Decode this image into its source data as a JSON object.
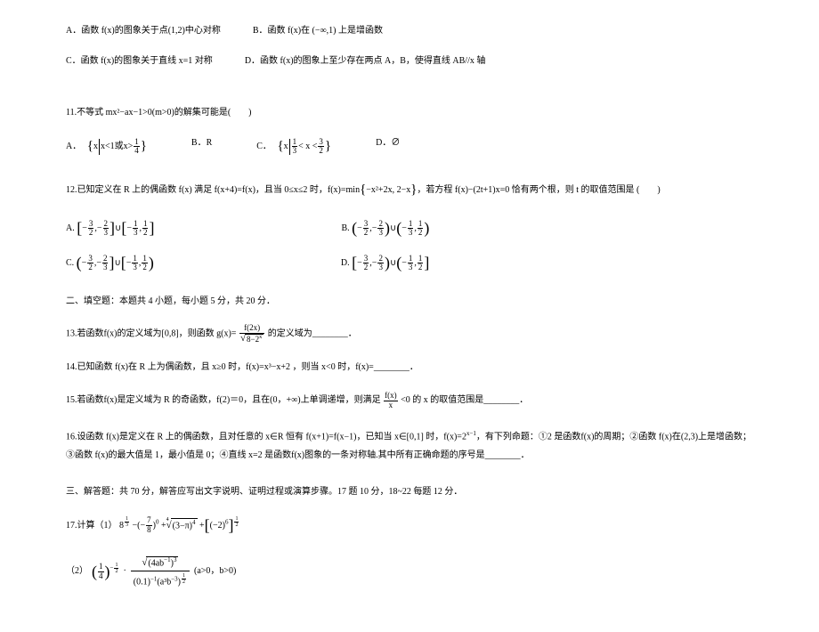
{
  "q10": {
    "A": "A．函数 f(x)的图象关于点(1,2)中心对称",
    "B": "B．函数 f(x)在 (−∞,1) 上是增函数",
    "C": "C．函数 f(x)的图象关于直线 x=1 对称",
    "D": "D．函数 f(x)的图象上至少存在两点 A，B，使得直线 AB//x 轴"
  },
  "q11": {
    "stem": "11.不等式 mx²−ax−1>0(m>0)的解集可能是(　　)",
    "A_label": "A．",
    "A_set_prefix": "x",
    "A_set_text1": "x<1或x>",
    "A_frac_n": "1",
    "A_frac_d": "4",
    "B": "B．R",
    "C_label": "C．",
    "C_set_prefix": "x",
    "C_frac1_n": "1",
    "C_frac1_d": "3",
    "C_mid": "< x <",
    "C_frac2_n": "3",
    "C_frac2_d": "2",
    "D": "D．∅"
  },
  "q12": {
    "stem_pre": "12.已知定义在 R 上的偶函数 f(x) 满足 f(x+4)=f(x)，且当 0≤x≤2 时，f(x)=min",
    "stem_set": "−x²+2x, 2−x",
    "stem_post": "，若方程 f(x)−(2t+1)x=0 恰有两个根，则 t 的取值范围是 (　　)",
    "A_label": "A.",
    "B_label": "B.",
    "C_label": "C.",
    "D_label": "D.",
    "n3": "3",
    "n2": "2",
    "n1": "1",
    "d2": "2",
    "d3": "3"
  },
  "sec2": "二、填空题：本题共 4 小题，每小题 5 分，共 20 分．",
  "q13": {
    "pre": "13.若函数f(x)的定义域为[0,8]，则函数 g(x)=",
    "num": "f(2x)",
    "den_pre": "8−2",
    "den_sup": "x",
    "post": "的定义域为________．"
  },
  "q14": "14.已知函数 f(x)在 R 上为偶函数，且 x≥0 时，f(x)=x³−x+2 ，则当 x<0 时，f(x)=________．",
  "q15": {
    "pre": "15.若函数f(x)是定义域为 R 的奇函数，f(2)＝0，且在(0，+∞)上单调递增，则满足",
    "num": "f(x)",
    "den": "x",
    "post": "<0 的 x 的取值范围是________．"
  },
  "q16": {
    "pre": "16.设函数 f(x)是定义在 R 上的偶函数，且对任意的 x∈R 恒有 f(x+1)=f(x−1)，已知当 x∈[0,1] 时，f(x)=2",
    "exp": "x−1",
    "mid": "，有下列命题：①2 是函数f(x)的周期；②函数 f(x)在(2,3)上是增函数；③函数 f(x)的最大值是 1，最小值是 0；④直线 x=2 是函数f(x)图象的一条对称轴.其中所有正确命题的序号是________．"
  },
  "sec3": "三、解答题：共 70 分，解答应写出文字说明、证明过程或演算步骤。17 题 10 分，18~22 每题 12 分．",
  "q17": {
    "label": "17.计算（1）",
    "t1_base": "8",
    "t1_expn": "1",
    "t1_expd": "3",
    "t2_base": "7",
    "t2_den": "8",
    "t2_exp": "0",
    "t3_inner": "(3−π)",
    "t3_pow": "4",
    "t3_idx": "4",
    "t4_inner": "(−2)",
    "t4_pow": "6",
    "t4_outn": "1",
    "t4_outd": "2",
    "p2_label": "（2）",
    "p2_a_n": "1",
    "p2_a_d": "4",
    "p2_a_expn": "1",
    "p2_a_expd": "2",
    "p2_num_inner": "(4ab",
    "p2_num_innerexp": "−1",
    "p2_num_innerclose": ")",
    "p2_num_pow": "3",
    "p2_num_idx": "",
    "p2_den_a": "(0.1)",
    "p2_den_aexp": "−1",
    "p2_den_b": "(a³b",
    "p2_den_bexp": "−3",
    "p2_den_bclose": ")",
    "p2_den_outn": "1",
    "p2_den_outd": "2",
    "p2_cond": "(a>0，b>0)"
  }
}
